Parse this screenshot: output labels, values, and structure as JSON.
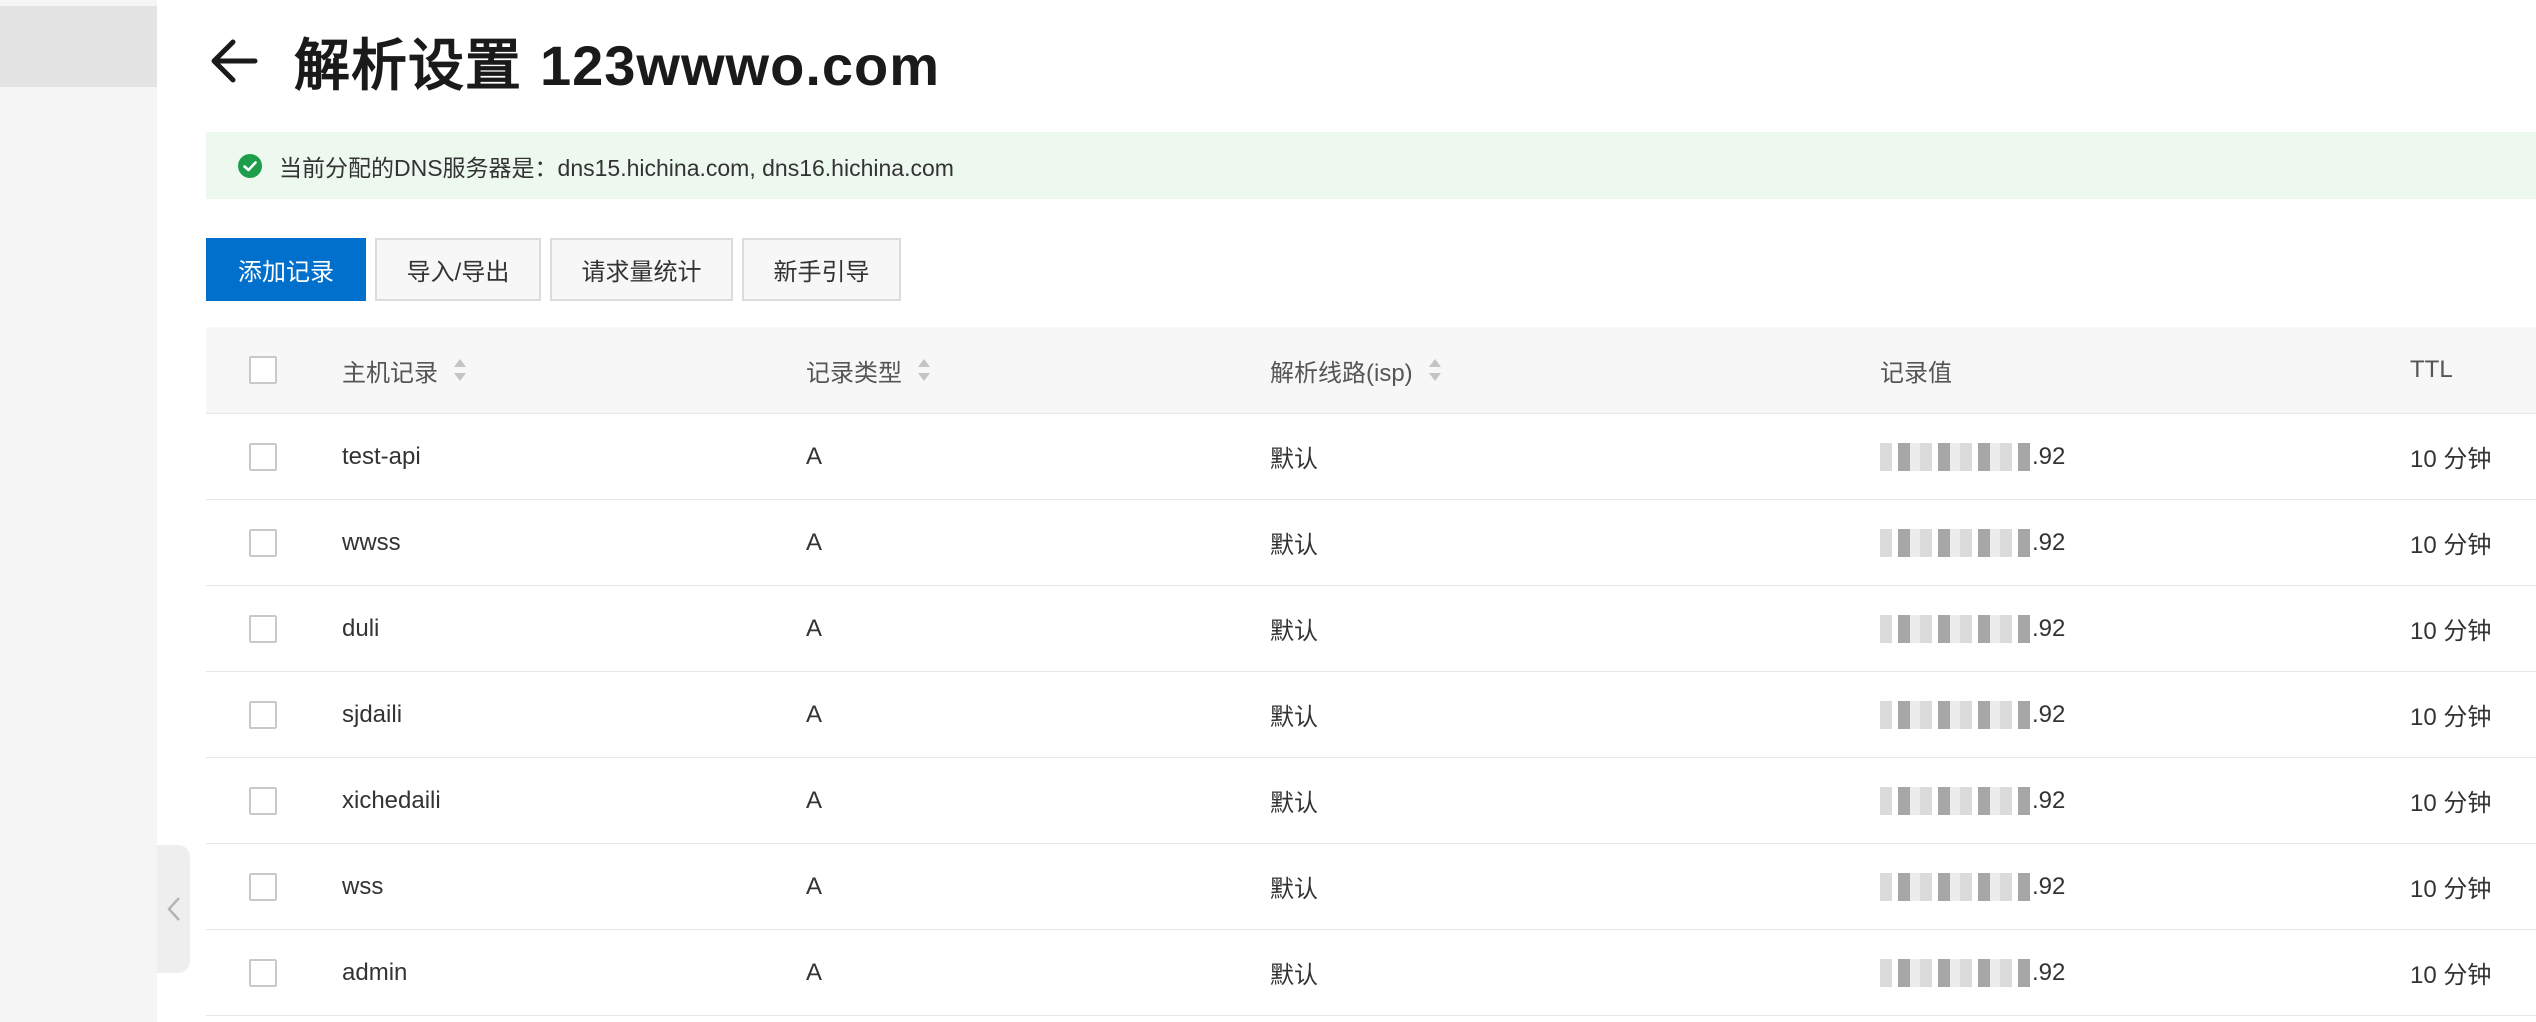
{
  "header": {
    "title": "解析设置",
    "domain": "123wwwo.com"
  },
  "notice": {
    "text": "当前分配的DNS服务器是：dns15.hichina.com, dns16.hichina.com"
  },
  "toolbar": {
    "add_record": "添加记录",
    "import_export": "导入/导出",
    "request_stats": "请求量统计",
    "beginner_guide": "新手引导"
  },
  "table": {
    "columns": {
      "host": "主机记录",
      "type": "记录类型",
      "line": "解析线路(isp)",
      "value": "记录值",
      "ttl": "TTL"
    },
    "rows": [
      {
        "host": "test-api",
        "type": "A",
        "line": "默认",
        "value_suffix": ".92",
        "ttl": "10 分钟"
      },
      {
        "host": "wwss",
        "type": "A",
        "line": "默认",
        "value_suffix": ".92",
        "ttl": "10 分钟"
      },
      {
        "host": "duli",
        "type": "A",
        "line": "默认",
        "value_suffix": ".92",
        "ttl": "10 分钟"
      },
      {
        "host": "sjdaili",
        "type": "A",
        "line": "默认",
        "value_suffix": ".92",
        "ttl": "10 分钟"
      },
      {
        "host": "xichedaili",
        "type": "A",
        "line": "默认",
        "value_suffix": ".92",
        "ttl": "10 分钟"
      },
      {
        "host": "wss",
        "type": "A",
        "line": "默认",
        "value_suffix": ".92",
        "ttl": "10 分钟"
      },
      {
        "host": "admin",
        "type": "A",
        "line": "默认",
        "value_suffix": ".92",
        "ttl": "10 分钟"
      }
    ]
  },
  "colors": {
    "primary": "#0070cc",
    "notice_bg": "#edf9ef",
    "success": "#1e9e4a"
  },
  "icons": {
    "back": "arrow-left-icon",
    "notice": "check-circle-icon",
    "sort": "sort-icon",
    "collapse": "chevron-left-icon"
  }
}
